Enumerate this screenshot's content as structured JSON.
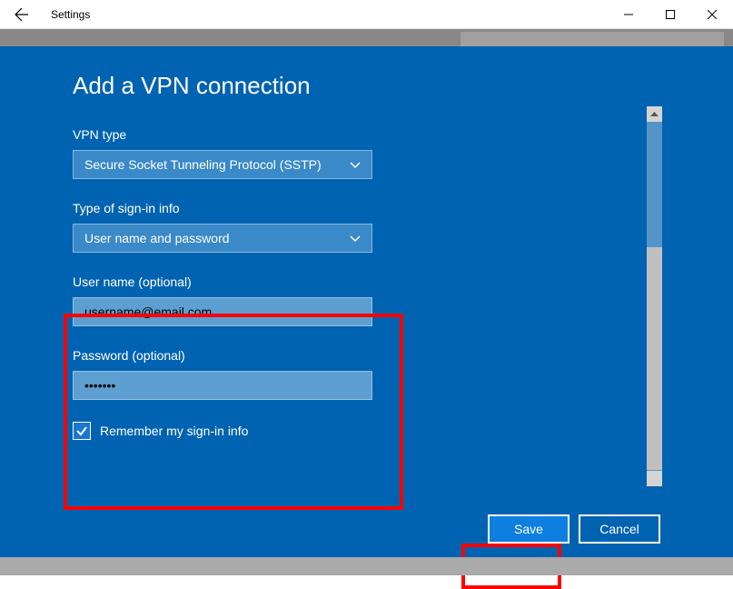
{
  "titlebar": {
    "title": "Settings"
  },
  "modal": {
    "title": "Add a VPN connection",
    "vpn_type": {
      "label": "VPN type",
      "value": "Secure Socket Tunneling Protocol (SSTP)"
    },
    "signin_type": {
      "label": "Type of sign-in info",
      "value": "User name and password"
    },
    "username": {
      "label": "User name (optional)",
      "value": "username@email.com"
    },
    "password": {
      "label": "Password (optional)",
      "value": "•••••••"
    },
    "remember": {
      "label": "Remember my sign-in info",
      "checked": true
    },
    "buttons": {
      "save": "Save",
      "cancel": "Cancel"
    }
  }
}
